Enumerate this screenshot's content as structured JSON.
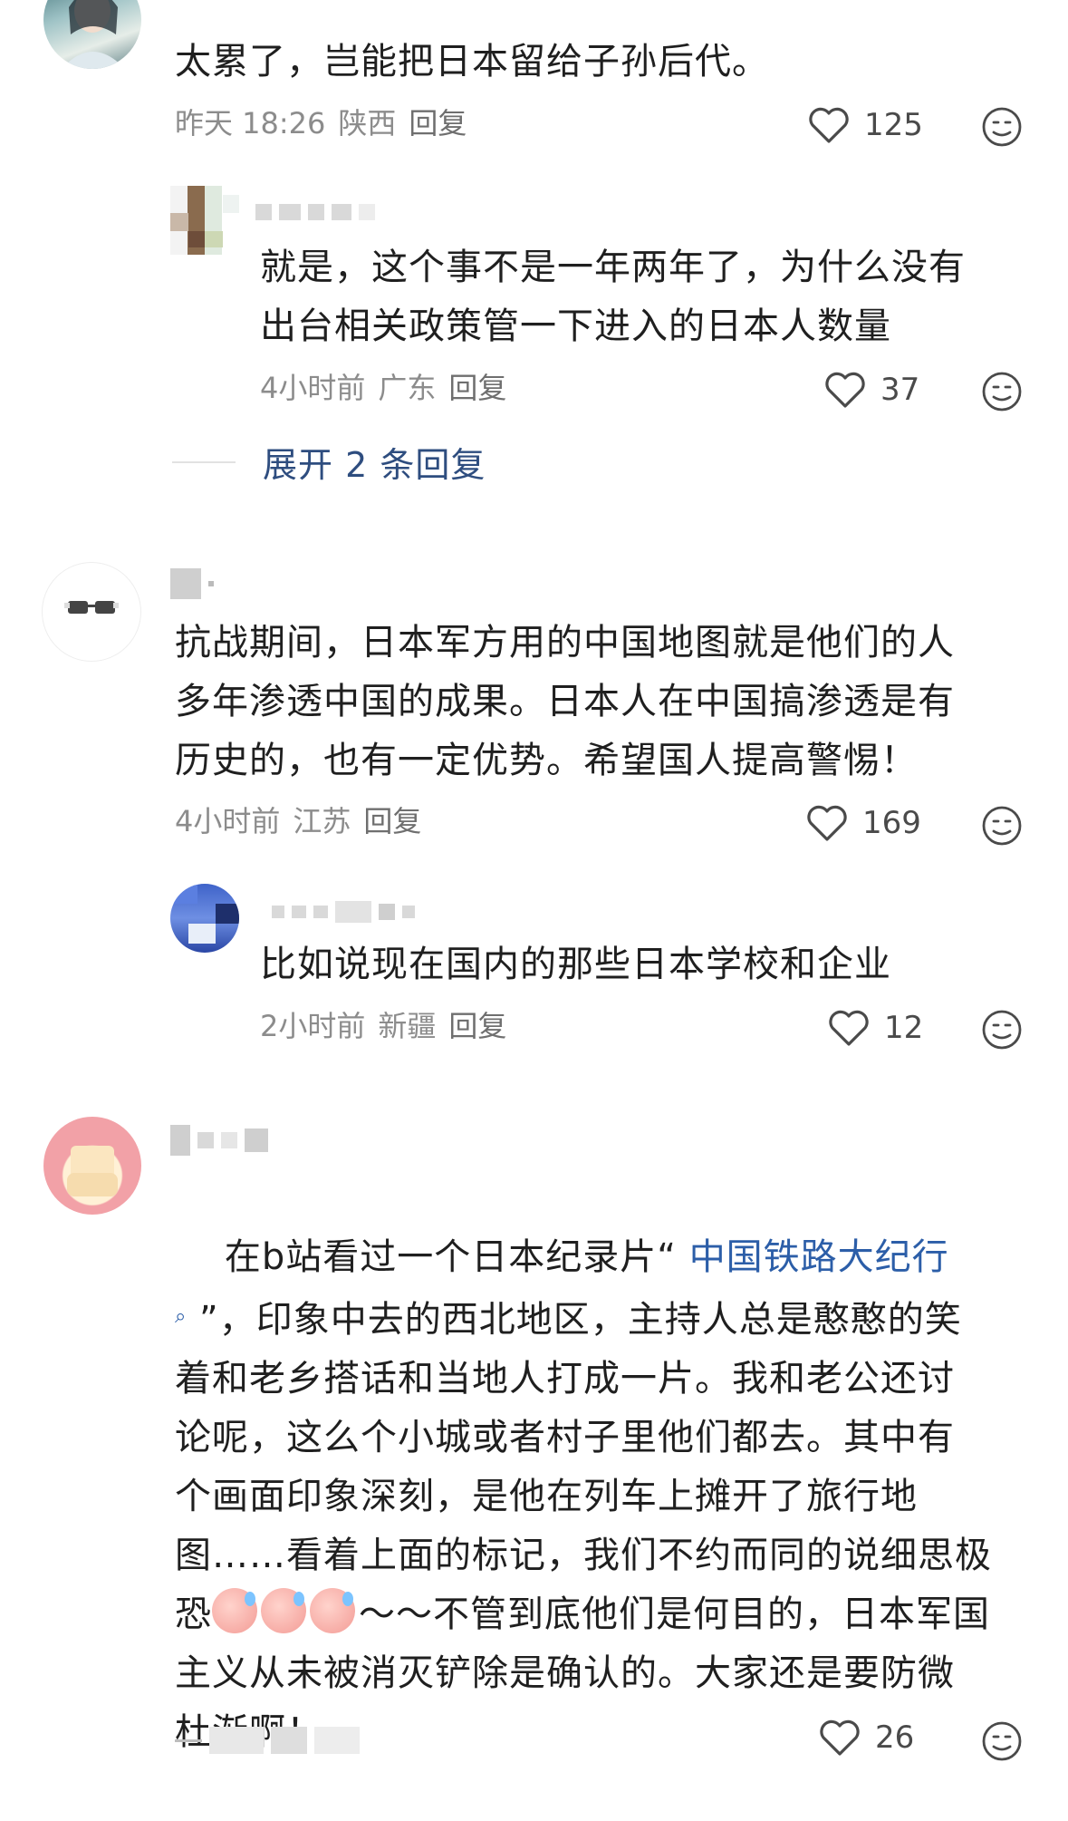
{
  "comments": [
    {
      "text": "太累了，岂能把日本留给子孙后代。",
      "time": "昨天 18:26",
      "location": "陕西",
      "reply": "回复",
      "likes": "125",
      "replies": [
        {
          "text": "就是，这个事不是一年两年了，为什么没有\n出台相关政策管一下进入的日本人数量",
          "time": "4小时前",
          "location": "广东",
          "reply": "回复",
          "likes": "37"
        }
      ],
      "expand_label": "展开 2 条回复"
    },
    {
      "text": "抗战期间，日本军方用的中国地图就是他们的人\n多年渗透中国的成果。日本人在中国搞渗透是有\n历史的，也有一定优势。希望国人提高警惕！",
      "time": "4小时前",
      "location": "江苏",
      "reply": "回复",
      "likes": "169",
      "replies": [
        {
          "text": "比如说现在国内的那些日本学校和企业",
          "time": "2小时前",
          "location": "新疆",
          "reply": "回复",
          "likes": "12"
        }
      ]
    },
    {
      "text_before_link": "在b站看过一个日本纪录片“ ",
      "link_text": "中国铁路大纪行",
      "text_after_link": "”，印象中去的西北地区，主持人总是憨憨的笑\n着和老乡搭话和当地人打成一片。我和老公还讨\n论呢，这么个小城或者村子里他们都去。其中有\n个画面印象深刻，是他在列车上摊开了旅行地\n图……看着上面的标记，我们不约而同的说细思极\n恐",
      "text_after_stickers": "～～不管到底他们是何目的，日本军国\n主义从未被消灭铲除是确认的。大家还是要防微\n杜渐啊！",
      "likes": "26"
    }
  ],
  "icons": {
    "like": "heart-outline-icon",
    "emoji": "emoji-face-icon",
    "search": "search-icon",
    "sticker": "crying-sticker"
  },
  "colors": {
    "link": "#2c5ea8",
    "expand": "#2e4d7f",
    "meta": "#8c8c8c"
  }
}
